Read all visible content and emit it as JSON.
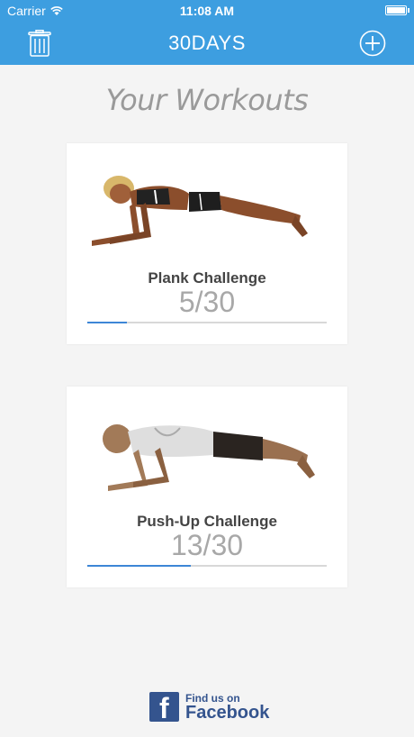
{
  "status_bar": {
    "carrier": "Carrier",
    "time": "11:08 AM"
  },
  "nav": {
    "title": "30DAYS",
    "left_icon": "trash-icon",
    "right_icon": "plus-circle-icon"
  },
  "page": {
    "heading": "Your Workouts"
  },
  "workouts": [
    {
      "name": "Plank Challenge",
      "progress_text": "5/30",
      "completed": 5,
      "total": 30
    },
    {
      "name": "Push-Up Challenge",
      "progress_text": "13/30",
      "completed": 13,
      "total": 30
    }
  ],
  "facebook": {
    "line1": "Find us on",
    "line2": "Facebook",
    "icon_letter": "f"
  },
  "colors": {
    "accent": "#3d9ee0",
    "progress": "#3d86d6",
    "facebook": "#34548e"
  }
}
